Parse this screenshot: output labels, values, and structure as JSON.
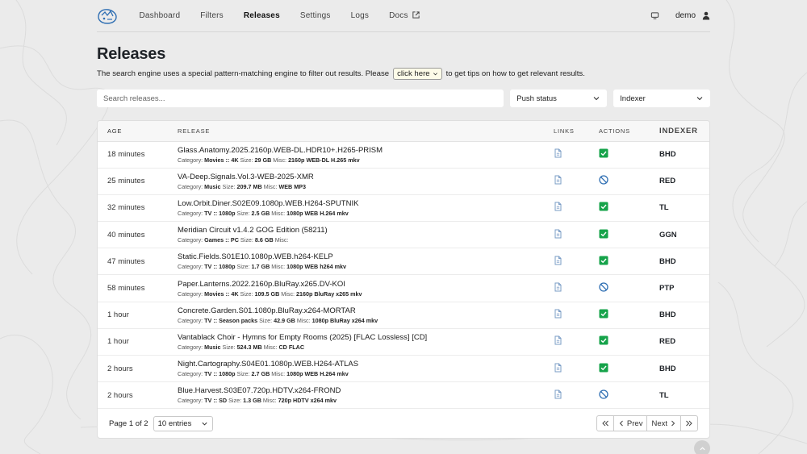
{
  "nav": {
    "items": [
      {
        "label": "Dashboard"
      },
      {
        "label": "Filters"
      },
      {
        "label": "Releases"
      },
      {
        "label": "Settings"
      },
      {
        "label": "Logs"
      },
      {
        "label": "Docs"
      }
    ],
    "active": "Releases",
    "user": "demo"
  },
  "header": {
    "title": "Releases",
    "subtitle_before": "The search engine uses a special pattern-matching engine to filter out results. Please",
    "click_here": "click here",
    "subtitle_after": "to get tips on how to get relevant results."
  },
  "filters": {
    "search_placeholder": "Search releases...",
    "push_status": "Push status",
    "indexer": "Indexer"
  },
  "table": {
    "headers": {
      "age": "AGE",
      "release": "RELEASE",
      "links": "LINKS",
      "actions": "ACTIONS",
      "indexer": "INDEXER"
    },
    "meta_labels": {
      "category": "Category:",
      "size": "Size:",
      "misc": "Misc:"
    },
    "rows": [
      {
        "age": "18 minutes",
        "name": "Glass.Anatomy.2025.2160p.WEB-DL.HDR10+.H265-PRISM",
        "category": "Movies :: 4K",
        "size": "29 GB",
        "misc": "2160p WEB-DL H.265 mkv",
        "status": "approved",
        "indexer": "BHD"
      },
      {
        "age": "25 minutes",
        "name": "VA-Deep.Signals.Vol.3-WEB-2025-XMR",
        "category": "Music",
        "size": "209.7 MB",
        "misc": "WEB MP3",
        "status": "rejected",
        "indexer": "RED"
      },
      {
        "age": "32 minutes",
        "name": "Low.Orbit.Diner.S02E09.1080p.WEB.H264-SPUTNIK",
        "category": "TV :: 1080p",
        "size": "2.5 GB",
        "misc": "1080p WEB H.264 mkv",
        "status": "approved",
        "indexer": "TL"
      },
      {
        "age": "40 minutes",
        "name": "Meridian Circuit v1.4.2 GOG Edition (58211)",
        "category": "Games :: PC",
        "size": "8.6 GB",
        "misc": "",
        "status": "approved",
        "indexer": "GGN"
      },
      {
        "age": "47 minutes",
        "name": "Static.Fields.S01E10.1080p.WEB.h264-KELP",
        "category": "TV :: 1080p",
        "size": "1.7 GB",
        "misc": "1080p WEB h264 mkv",
        "status": "approved",
        "indexer": "BHD"
      },
      {
        "age": "58 minutes",
        "name": "Paper.Lanterns.2022.2160p.BluRay.x265.DV-KOI",
        "category": "Movies :: 4K",
        "size": "109.5 GB",
        "misc": "2160p BluRay x265 mkv",
        "status": "rejected",
        "indexer": "PTP"
      },
      {
        "age": "1 hour",
        "name": "Concrete.Garden.S01.1080p.BluRay.x264-MORTAR",
        "category": "TV :: Season packs",
        "size": "42.9 GB",
        "misc": "1080p BluRay x264 mkv",
        "status": "approved",
        "indexer": "BHD"
      },
      {
        "age": "1 hour",
        "name": "Vantablack Choir - Hymns for Empty Rooms (2025) [FLAC Lossless] [CD]",
        "category": "Music",
        "size": "524.3 MB",
        "misc": "CD FLAC",
        "status": "approved",
        "indexer": "RED"
      },
      {
        "age": "2 hours",
        "name": "Night.Cartography.S04E01.1080p.WEB.H264-ATLAS",
        "category": "TV :: 1080p",
        "size": "2.7 GB",
        "misc": "1080p WEB H.264 mkv",
        "status": "approved",
        "indexer": "BHD"
      },
      {
        "age": "2 hours",
        "name": "Blue.Harvest.S03E07.720p.HDTV.x264-FROND",
        "category": "TV :: SD",
        "size": "1.3 GB",
        "misc": "720p HDTV x264 mkv",
        "status": "rejected",
        "indexer": "TL"
      }
    ]
  },
  "footer": {
    "page_info": "Page 1 of 2",
    "page_size": "10 entries",
    "prev": "Prev",
    "next": "Next"
  },
  "colors": {
    "approved": "#16a34a",
    "rejected": "#2f6fb3",
    "link_icon": "#7a9cc6"
  }
}
